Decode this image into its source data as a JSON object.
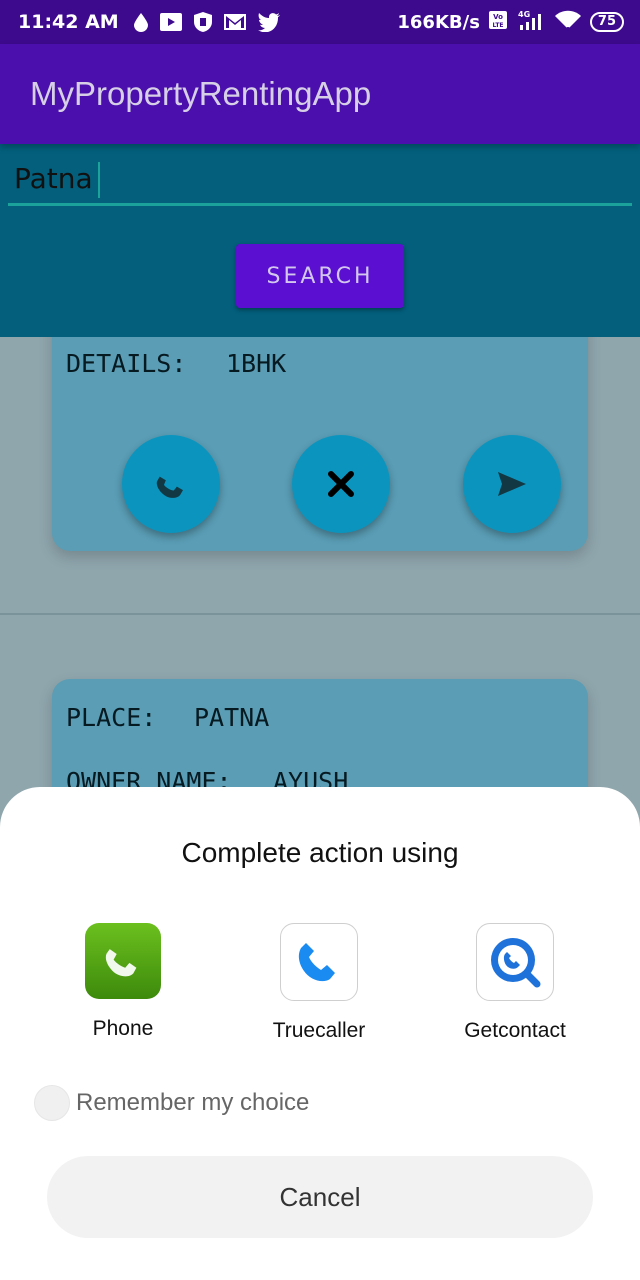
{
  "status_bar": {
    "time": "11:42 AM",
    "speed": "166KB/s",
    "network": "4G",
    "battery": "75"
  },
  "app_bar": {
    "title": "MyPropertyRentingApp"
  },
  "search": {
    "value": "Patna",
    "button_label": "SEARCH"
  },
  "listings": [
    {
      "details_label": "DETAILS:",
      "details_value": "1BHK"
    },
    {
      "place_label": "PLACE:",
      "place_value": "PATNA",
      "owner_label": "OWNER NAME:",
      "owner_value": "AYUSH"
    }
  ],
  "chooser": {
    "title": "Complete action using",
    "apps": [
      {
        "label": "Phone",
        "icon": "phone-app-icon"
      },
      {
        "label": "Truecaller",
        "icon": "truecaller-icon"
      },
      {
        "label": "Getcontact",
        "icon": "getcontact-icon"
      }
    ],
    "remember_label": "Remember my choice",
    "cancel_label": "Cancel"
  },
  "colors": {
    "status_bar": "#3d0a8e",
    "app_bar": "#4a0fad",
    "search_panel": "#035f7c",
    "search_button": "#5a0fd1",
    "card": "#5a9db5",
    "fab": "#0b95be"
  }
}
